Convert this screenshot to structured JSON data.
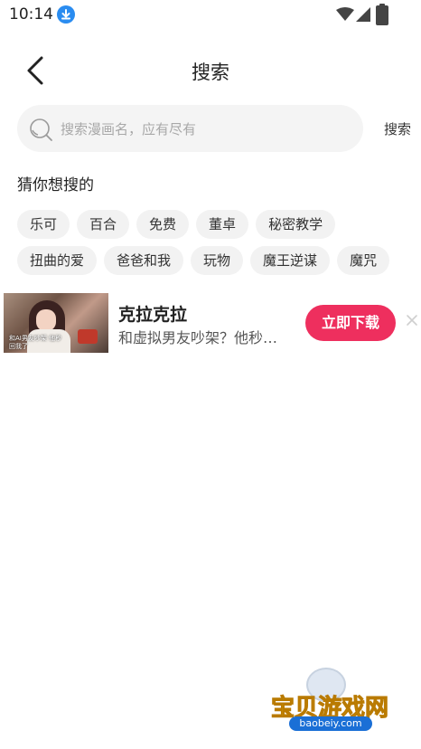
{
  "status_bar": {
    "time": "10:14"
  },
  "header": {
    "title": "搜索"
  },
  "search": {
    "placeholder": "搜索漫画名，应有尽有",
    "button_label": "搜索"
  },
  "suggestions": {
    "heading": "猜你想搜的",
    "rows": [
      [
        "乐可",
        "百合",
        "免费",
        "董卓",
        "秘密教学"
      ],
      [
        "扭曲的爱",
        "爸爸和我",
        "玩物",
        "魔王逆谋",
        "魔咒"
      ]
    ]
  },
  "ad": {
    "title": "克拉克拉",
    "description": "和虚拟男友吵架？他秒…",
    "download_label": "立即下载",
    "thumb_caption": "和AI男友吵架 他秒回我了"
  },
  "watermark": {
    "text": "宝贝游戏网",
    "url": "baobeiy.com"
  },
  "colors": {
    "accent": "#ee2f5e",
    "download_icon": "#2a8cf0",
    "watermark_gold": "#f0b400",
    "watermark_blue": "#1a6fd6"
  }
}
